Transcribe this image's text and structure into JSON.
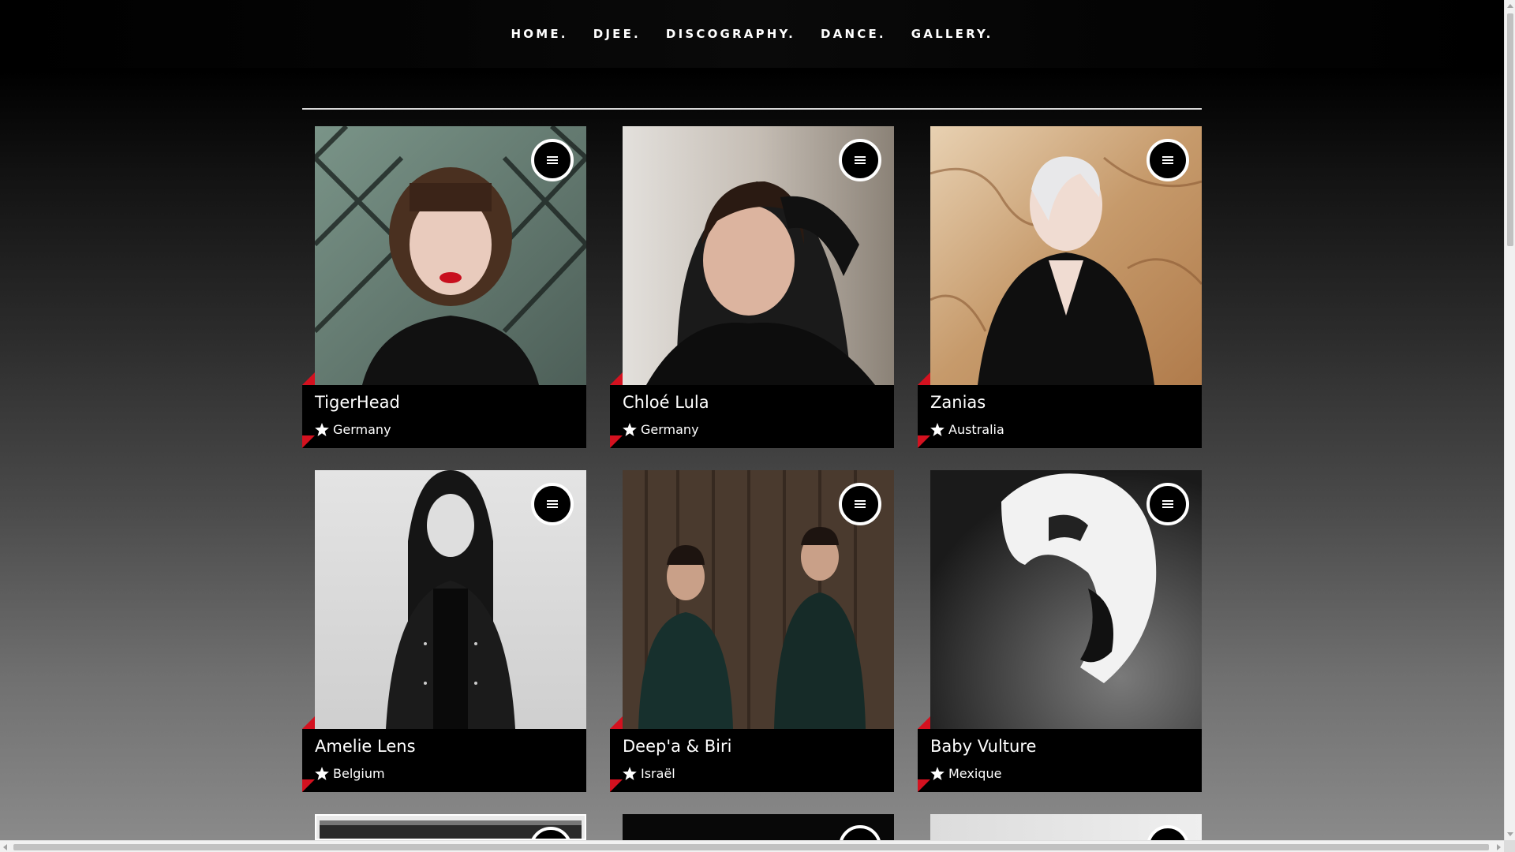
{
  "nav": {
    "items": [
      "HOME.",
      "DJEE.",
      "DISCOGRAPHY.",
      "DANCE.",
      "GALLERY."
    ]
  },
  "artists": [
    {
      "name": "TigerHead",
      "country": "Germany"
    },
    {
      "name": "Chloé Lula",
      "country": "Germany"
    },
    {
      "name": "Zanias",
      "country": "Australia"
    },
    {
      "name": "Amelie Lens",
      "country": "Belgium"
    },
    {
      "name": "Deep'a & Biri",
      "country": "Israël"
    },
    {
      "name": "Baby Vulture",
      "country": "Mexique"
    }
  ],
  "icons": {
    "menu": "menu-lines-icon",
    "country": "star-icon"
  },
  "colors": {
    "accent": "#d4111f",
    "card_bg": "#000000",
    "text": "#ffffff"
  }
}
